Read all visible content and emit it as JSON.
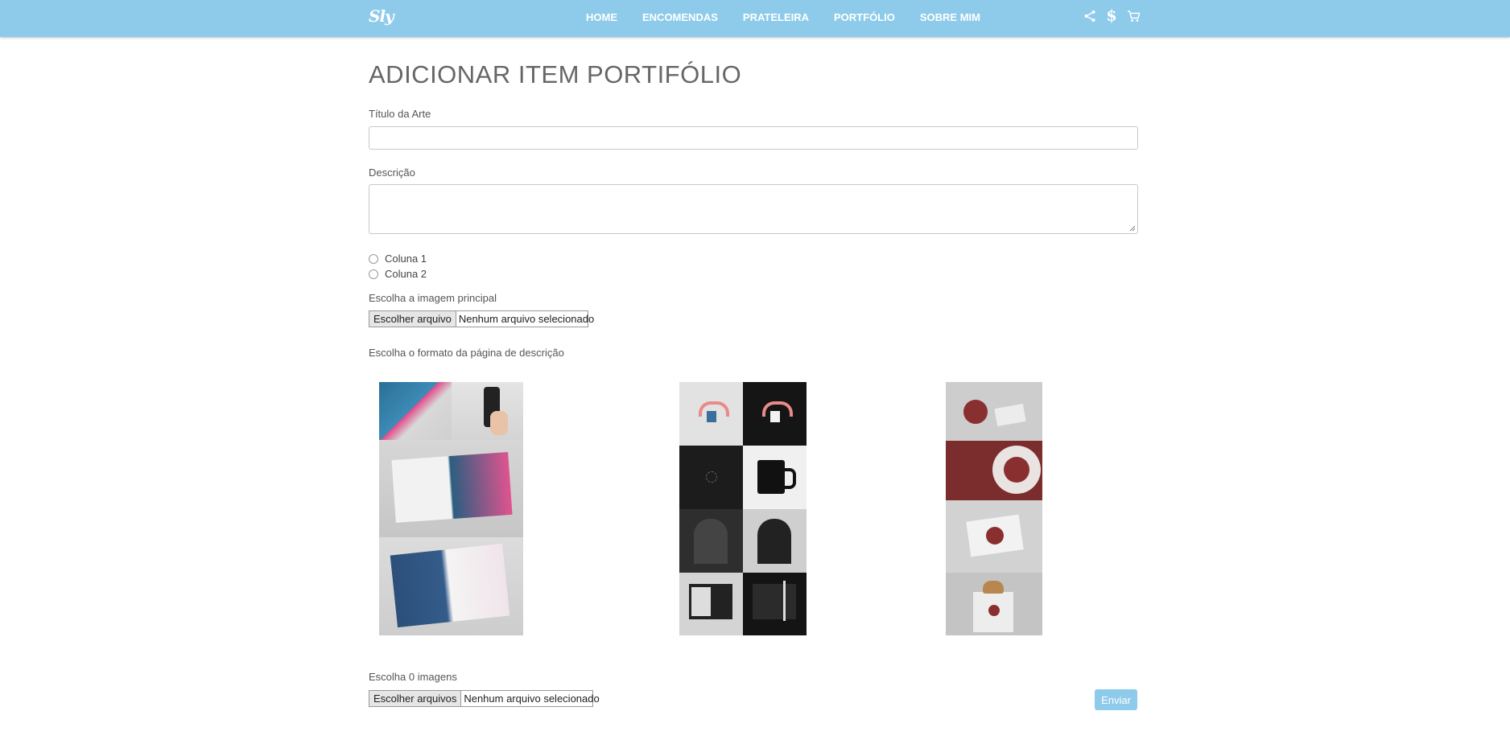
{
  "nav": {
    "brand": "Sly",
    "links": [
      "HOME",
      "ENCOMENDAS",
      "PRATELEIRA",
      "PORTFÓLIO",
      "SOBRE MIM"
    ],
    "icons": [
      "share-icon",
      "dollar-icon",
      "cart-icon"
    ]
  },
  "page": {
    "title": "ADICIONAR ITEM PORTIFÓLIO"
  },
  "form": {
    "title_label": "Título da Arte",
    "title_value": "",
    "description_label": "Descrição",
    "description_value": "",
    "column_options": [
      "Coluna 1",
      "Coluna 2"
    ],
    "main_image_label": "Escolha a imagem principal",
    "main_image_button": "Escolher arquivo",
    "main_image_status": "Nenhum arquivo selecionado",
    "format_label": "Escolha o formato da página de descrição",
    "layout_options": [
      "layout-option-1",
      "layout-option-2",
      "layout-option-3"
    ],
    "images_label": "Escolha 0 imagens",
    "images_button": "Escolher arquivos",
    "images_status": "Nenhum arquivo selecionado",
    "submit_label": "Enviar"
  },
  "colors": {
    "navbar": "#8ecbeb",
    "submit": "#8ecbeb"
  }
}
